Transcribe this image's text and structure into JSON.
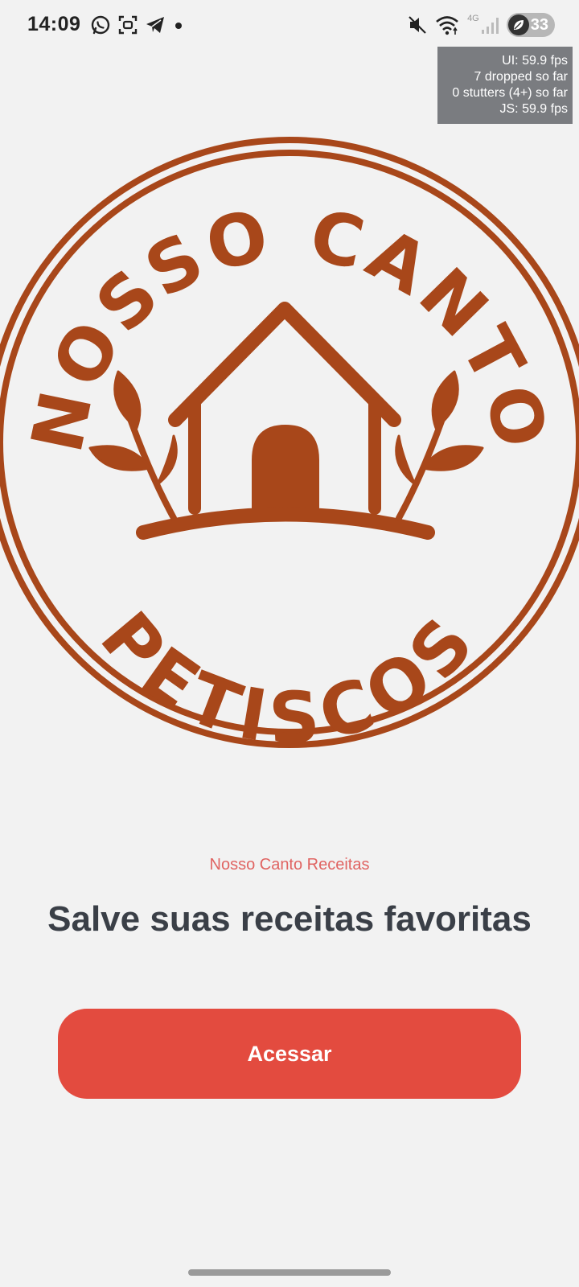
{
  "status_bar": {
    "time": "14:09",
    "network_label": "4G",
    "battery_level": "33",
    "left_icons": [
      "whatsapp-icon",
      "scan-icon",
      "telegram-icon",
      "dot-icon"
    ],
    "right_icons": [
      "mute-icon",
      "wifi-icon",
      "signal-icon",
      "battery-icon"
    ]
  },
  "perf_overlay": {
    "ui_fps": "UI: 59.9 fps",
    "dropped": "7 dropped so far",
    "stutters": "0 stutters (4+) so far",
    "js_fps": "JS: 59.9 fps"
  },
  "logo": {
    "text_top": "NOSSO CANTO",
    "text_bottom": "PETISCOS",
    "color": "#a8471a",
    "icon": "house-with-leaves-icon"
  },
  "content": {
    "brand_label": "Nosso Canto Receitas",
    "headline": "Salve suas receitas favoritas",
    "cta_label": "Acessar"
  },
  "colors": {
    "background": "#f2f2f2",
    "accent": "#e34b3f",
    "brand_label": "#e06462",
    "headline": "#3a3f47"
  }
}
